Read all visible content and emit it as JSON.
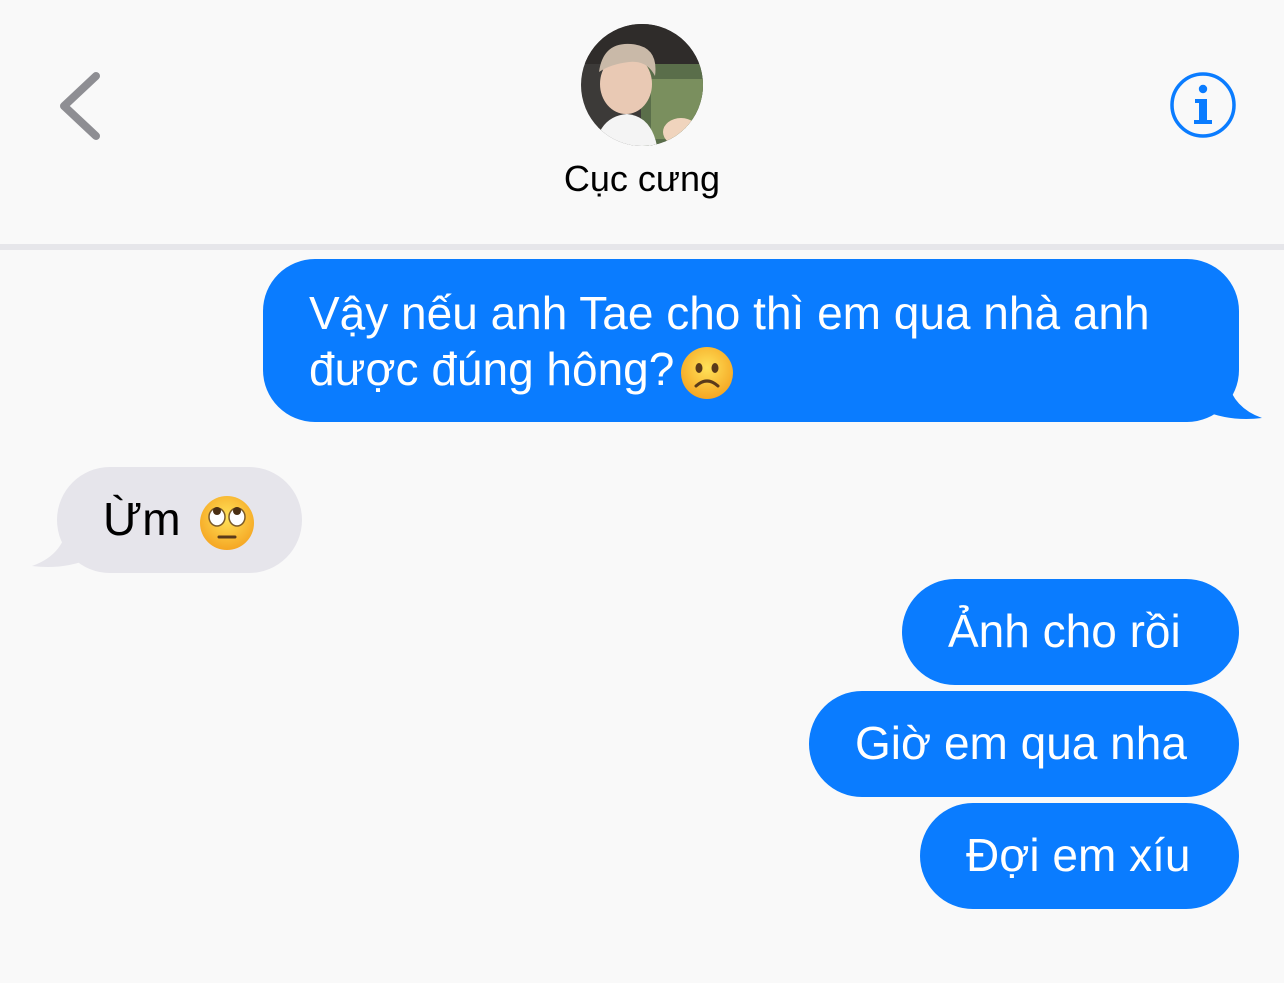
{
  "header": {
    "contact_name": "Cục cưng",
    "back_icon": "chevron-left-icon",
    "info_icon": "info-circle-icon",
    "accent_color": "#0a7cff"
  },
  "messages": [
    {
      "direction": "outgoing",
      "lines": [
        "Vậy nếu anh Tae cho thì em qua nhà anh",
        "được đúng hông?"
      ],
      "emoji": "slightly-frowning-face-emoji"
    },
    {
      "direction": "incoming",
      "text": "Ừm",
      "emoji": "face-with-rolling-eyes-emoji"
    },
    {
      "direction": "outgoing",
      "text": "Ảnh cho rồi"
    },
    {
      "direction": "outgoing",
      "text": "Giờ em qua nha"
    },
    {
      "direction": "outgoing",
      "text": "Đợi em xíu"
    }
  ],
  "colors": {
    "outgoing_bubble": "#0a7cff",
    "incoming_bubble": "#e6e5eb",
    "background": "#f9f9f9"
  }
}
